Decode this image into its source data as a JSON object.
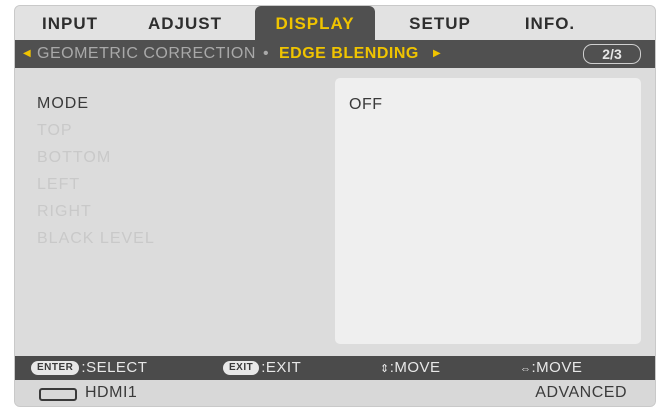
{
  "tabs": {
    "input": "INPUT",
    "adjust": "ADJUST",
    "display": "DISPLAY",
    "setup": "SETUP",
    "info": "INFO."
  },
  "breadcrumb": {
    "prev": "GEOMETRIC CORRECTION",
    "separator": "•",
    "current": "EDGE BLENDING",
    "page": "2/3"
  },
  "menu": {
    "items": [
      "MODE",
      "TOP",
      "BOTTOM",
      "LEFT",
      "RIGHT",
      "BLACK LEVEL"
    ]
  },
  "value": {
    "mode": "OFF"
  },
  "hints": {
    "enter_key": "ENTER",
    "enter_label": ":SELECT",
    "exit_key": "EXIT",
    "exit_label": ":EXIT",
    "updown_label": ":MOVE",
    "leftright_label": ":MOVE"
  },
  "status": {
    "source": "HDMI1",
    "mode": "ADVANCED"
  },
  "colors": {
    "accent": "#f0c400",
    "bar": "#505050",
    "panel": "#dcdcdc"
  }
}
